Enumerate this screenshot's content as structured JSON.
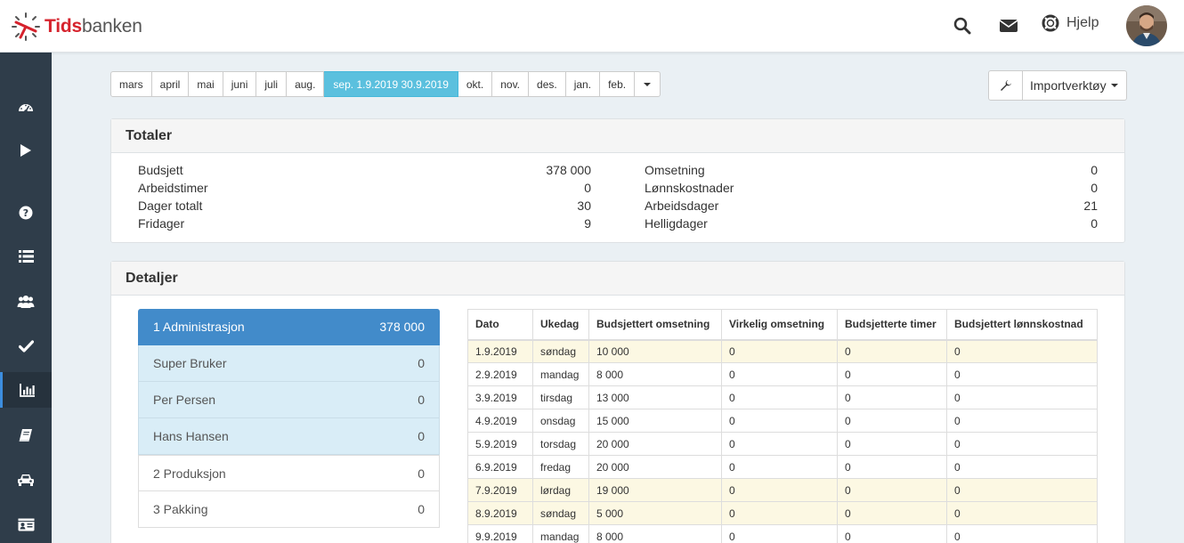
{
  "app": {
    "brand_part1": "Tids",
    "brand_part2": "banken"
  },
  "header": {
    "help_label": "Hjelp"
  },
  "sidebar": {
    "items": [
      {
        "icon": "dashboard-icon"
      },
      {
        "icon": "play-icon"
      },
      {
        "icon": "question-icon"
      },
      {
        "icon": "list-icon"
      },
      {
        "icon": "users-icon"
      },
      {
        "icon": "check-icon"
      },
      {
        "icon": "bar-chart-icon",
        "active": true
      },
      {
        "icon": "book-icon"
      },
      {
        "icon": "car-icon"
      },
      {
        "icon": "id-card-icon"
      }
    ]
  },
  "months": [
    {
      "label": "mars"
    },
    {
      "label": "april"
    },
    {
      "label": "mai"
    },
    {
      "label": "juni"
    },
    {
      "label": "juli"
    },
    {
      "label": "aug."
    },
    {
      "label": "sep. 1.9.2019 30.9.2019",
      "active": true
    },
    {
      "label": "okt."
    },
    {
      "label": "nov."
    },
    {
      "label": "des."
    },
    {
      "label": "jan."
    },
    {
      "label": "feb."
    }
  ],
  "import_tool": {
    "label": "Importverktøy"
  },
  "totals": {
    "title": "Totaler",
    "left": [
      {
        "label": "Budsjett",
        "value": "378 000"
      },
      {
        "label": "Arbeidstimer",
        "value": "0"
      },
      {
        "label": "Dager totalt",
        "value": "30"
      },
      {
        "label": "Fridager",
        "value": "9"
      }
    ],
    "right": [
      {
        "label": "Omsetning",
        "value": "0"
      },
      {
        "label": "Lønnskostnader",
        "value": "0"
      },
      {
        "label": "Arbeidsdager",
        "value": "21"
      },
      {
        "label": "Helligdager",
        "value": "0"
      }
    ]
  },
  "details": {
    "title": "Detaljer",
    "departments": [
      {
        "label": "1 Administrasjon",
        "value": "378 000",
        "style": "head"
      },
      {
        "label": "Super Bruker",
        "value": "0",
        "style": "sub"
      },
      {
        "label": "Per Persen",
        "value": "0",
        "style": "sub"
      },
      {
        "label": "Hans Hansen",
        "value": "0",
        "style": "sub"
      },
      {
        "label": "2 Produksjon",
        "value": "0",
        "style": "plain"
      },
      {
        "label": "3 Pakking",
        "value": "0",
        "style": "plain"
      }
    ],
    "columns": [
      "Dato",
      "Ukedag",
      "Budsjettert omsetning",
      "Virkelig omsetning",
      "Budsjetterte timer",
      "Budsjettert lønnskostnad"
    ],
    "rows": [
      {
        "date": "1.9.2019",
        "day": "søndag",
        "budget": "10 000",
        "actual": "0",
        "hours": "0",
        "wage": "0",
        "highlight": true
      },
      {
        "date": "2.9.2019",
        "day": "mandag",
        "budget": "8 000",
        "actual": "0",
        "hours": "0",
        "wage": "0"
      },
      {
        "date": "3.9.2019",
        "day": "tirsdag",
        "budget": "13 000",
        "actual": "0",
        "hours": "0",
        "wage": "0"
      },
      {
        "date": "4.9.2019",
        "day": "onsdag",
        "budget": "15 000",
        "actual": "0",
        "hours": "0",
        "wage": "0"
      },
      {
        "date": "5.9.2019",
        "day": "torsdag",
        "budget": "20 000",
        "actual": "0",
        "hours": "0",
        "wage": "0"
      },
      {
        "date": "6.9.2019",
        "day": "fredag",
        "budget": "20 000",
        "actual": "0",
        "hours": "0",
        "wage": "0"
      },
      {
        "date": "7.9.2019",
        "day": "lørdag",
        "budget": "19 000",
        "actual": "0",
        "hours": "0",
        "wage": "0",
        "highlight": true
      },
      {
        "date": "8.9.2019",
        "day": "søndag",
        "budget": "5 000",
        "actual": "0",
        "hours": "0",
        "wage": "0",
        "highlight": true
      },
      {
        "date": "9.9.2019",
        "day": "mandag",
        "budget": "8 000",
        "actual": "0",
        "hours": "0",
        "wage": "0"
      }
    ]
  },
  "colors": {
    "sidebar_bg": "#2f3d4a",
    "active_month": "#5bc0de",
    "department_head": "#428bca",
    "department_sub": "#d9edf7",
    "weekend_row": "#fcf8e3",
    "brand_red": "#d6232d"
  }
}
